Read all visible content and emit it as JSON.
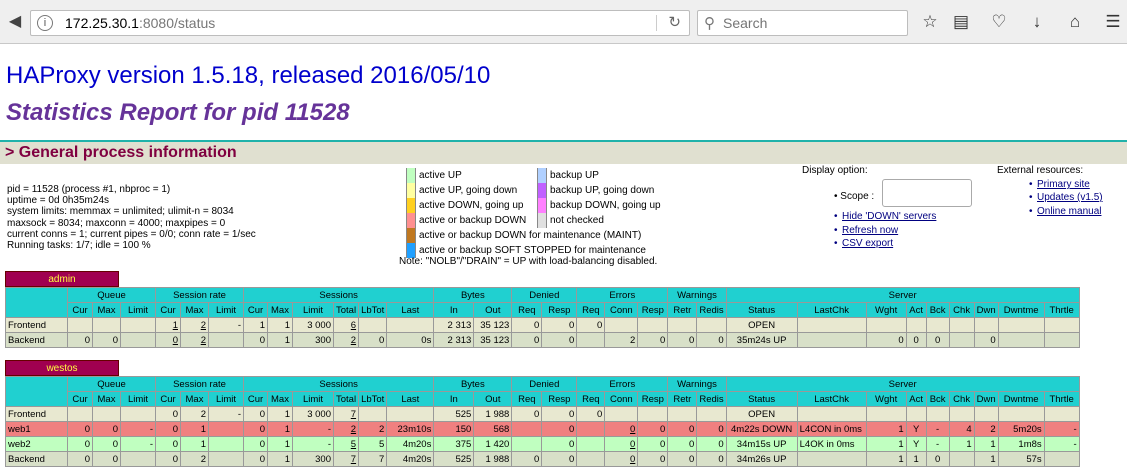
{
  "browser": {
    "url_host": "172.25.30.1",
    "url_rest": ":8080/status",
    "search_placeholder": "Search"
  },
  "header": {
    "version": "HAProxy version 1.5.18, released 2016/05/10",
    "report": "Statistics Report for pid 11528"
  },
  "general": {
    "title": "> General process information",
    "info_lines": [
      "pid = 11528 (process #1, nbproc = 1)",
      "uptime = 0d 0h35m24s",
      "system limits: memmax = unlimited; ulimit-n = 8034",
      "maxsock = 8034; maxconn = 4000; maxpipes = 0",
      "current conns = 1; current pipes = 0/0; conn rate = 1/sec",
      "Running tasks: 1/7; idle = 100 %"
    ],
    "legend_left": [
      {
        "color": "#c0ffc0",
        "label": "active UP"
      },
      {
        "color": "#ffffa0",
        "label": "active UP, going down"
      },
      {
        "color": "#ffd020",
        "label": "active DOWN, going up"
      },
      {
        "color": "#ff9090",
        "label": "active or backup DOWN"
      },
      {
        "color": "#c07820",
        "label": "active or backup DOWN for maintenance (MAINT)"
      },
      {
        "color": "#20a0ff",
        "label": "active or backup SOFT STOPPED for maintenance"
      }
    ],
    "legend_right": [
      {
        "color": "#b0d0ff",
        "label": "backup UP"
      },
      {
        "color": "#c060ff",
        "label": "backup UP, going down"
      },
      {
        "color": "#ff80ff",
        "label": "backup DOWN, going up"
      },
      {
        "color": "#e0e0e0",
        "label": "not checked"
      }
    ],
    "note": "Note: \"NOLB\"/\"DRAIN\" = UP with load-balancing disabled.",
    "display_option": "Display option:",
    "scope_label": "Scope :",
    "hide_down": "Hide 'DOWN' servers",
    "refresh_now": "Refresh now",
    "csv_export": "CSV export",
    "external_resources": "External resources:",
    "primary_site": "Primary site",
    "updates": "Updates (v1.5)",
    "online_manual": "Online manual"
  },
  "table_headers": {
    "groups": [
      "Queue",
      "Session rate",
      "Sessions",
      "Bytes",
      "Denied",
      "Errors",
      "Warnings",
      "Server"
    ],
    "cols": [
      "Cur",
      "Max",
      "Limit",
      "Cur",
      "Max",
      "Limit",
      "Cur",
      "Max",
      "Limit",
      "Total",
      "LbTot",
      "Last",
      "In",
      "Out",
      "Req",
      "Resp",
      "Req",
      "Conn",
      "Resp",
      "Retr",
      "Redis",
      "Status",
      "LastChk",
      "Wght",
      "Act",
      "Bck",
      "Chk",
      "Dwn",
      "Dwntme",
      "Thrtle"
    ]
  },
  "proxies": [
    {
      "name": "admin",
      "rows": [
        {
          "type": "fe",
          "cells": [
            "Frontend",
            "",
            "",
            "",
            "1",
            "2",
            "-",
            "1",
            "1",
            "3 000",
            "6",
            "",
            "",
            "2 313",
            "35 123",
            "0",
            "0",
            "0",
            "",
            "",
            "",
            "",
            "OPEN",
            "",
            "",
            "",
            "",
            "",
            "",
            "",
            ""
          ]
        },
        {
          "type": "be",
          "cells": [
            "Backend",
            "0",
            "0",
            "",
            "0",
            "2",
            "",
            "0",
            "1",
            "300",
            "2",
            "0",
            "0s",
            "2 313",
            "35 123",
            "0",
            "0",
            "",
            "2",
            "0",
            "0",
            "0",
            "35m24s UP",
            "",
            "0",
            "0",
            "0",
            "",
            "0",
            "",
            ""
          ]
        }
      ]
    },
    {
      "name": "westos",
      "rows": [
        {
          "type": "fe",
          "cells": [
            "Frontend",
            "",
            "",
            "",
            "0",
            "2",
            "-",
            "0",
            "1",
            "3 000",
            "7",
            "",
            "",
            "525",
            "1 988",
            "0",
            "0",
            "0",
            "",
            "",
            "",
            "",
            "OPEN",
            "",
            "",
            "",
            "",
            "",
            "",
            "",
            ""
          ]
        },
        {
          "type": "down",
          "cells": [
            "web1",
            "0",
            "0",
            "-",
            "0",
            "1",
            "",
            "0",
            "1",
            "-",
            "2",
            "2",
            "23m10s",
            "150",
            "568",
            "",
            "0",
            "",
            "0",
            "0",
            "0",
            "0",
            "4m22s DOWN",
            "L4CON in 0ms",
            "1",
            "Y",
            "-",
            "4",
            "2",
            "5m20s",
            "-"
          ]
        },
        {
          "type": "up",
          "cells": [
            "web2",
            "0",
            "0",
            "-",
            "0",
            "1",
            "",
            "0",
            "1",
            "-",
            "5",
            "5",
            "4m20s",
            "375",
            "1 420",
            "",
            "0",
            "",
            "0",
            "0",
            "0",
            "0",
            "34m15s UP",
            "L4OK in 0ms",
            "1",
            "Y",
            "-",
            "1",
            "1",
            "1m8s",
            "-"
          ]
        },
        {
          "type": "be",
          "cells": [
            "Backend",
            "0",
            "0",
            "",
            "0",
            "2",
            "",
            "0",
            "1",
            "300",
            "7",
            "7",
            "4m20s",
            "525",
            "1 988",
            "0",
            "0",
            "",
            "0",
            "0",
            "0",
            "0",
            "34m26s UP",
            "",
            "1",
            "1",
            "0",
            "",
            "1",
            "57s",
            ""
          ]
        }
      ]
    }
  ]
}
